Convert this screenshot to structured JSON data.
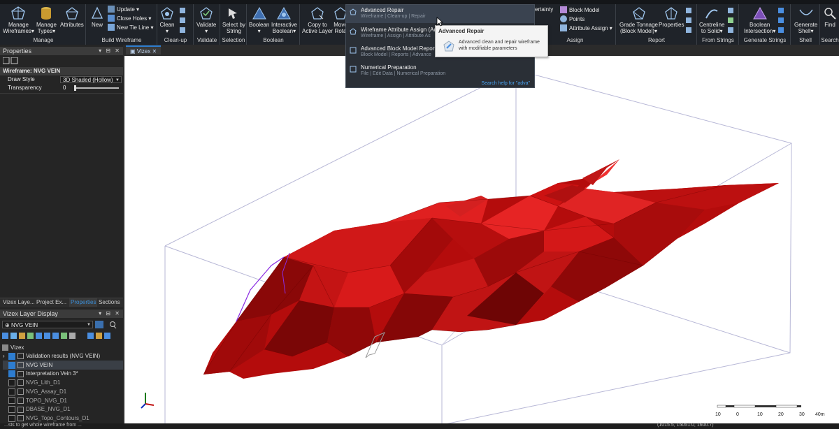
{
  "ribbon": {
    "groups": [
      {
        "label": "Manage",
        "buttons": [
          "Manage\nWireframes▾",
          "Manage\nTypes▾",
          "Attributes"
        ]
      },
      {
        "label": "Build Wireframe",
        "new": "New",
        "small": [
          "Update ▾",
          "Close Holes ▾",
          "New Tie Line ▾"
        ]
      },
      {
        "label": "Clean-up",
        "buttons": [
          "Clean\n▾"
        ]
      },
      {
        "label": "Validate",
        "buttons": [
          "Validate\n▾"
        ]
      },
      {
        "label": "Selection",
        "buttons": [
          "Select by\nString"
        ]
      },
      {
        "label": "Boolean",
        "buttons": [
          "Boolean\n▾",
          "Interactive\nBoolean▾"
        ]
      },
      {
        "label": "",
        "buttons": [
          "Copy to\nActive Layer",
          "Move\nRota"
        ]
      },
      {
        "label": "Assign",
        "small_left": "ertainty",
        "small": [
          "Block Model",
          "Points",
          "Attribute Assign ▾"
        ]
      },
      {
        "label": "Report",
        "buttons": [
          "Grade Tonnage\n(Block Model)▾",
          "Properties"
        ]
      },
      {
        "label": "From Strings",
        "buttons": [
          "Centreline\nto Solid▾"
        ]
      },
      {
        "label": "Generate Strings",
        "buttons": [
          "Boolean\nIntersection▾"
        ]
      },
      {
        "label": "Shell",
        "buttons": [
          "Generate\nShell▾"
        ]
      },
      {
        "label": "Search",
        "buttons": [
          "Find"
        ]
      }
    ]
  },
  "search_dropdown": {
    "items": [
      {
        "title": "Advanced Repair",
        "path": "Wireframe | Clean-up | Repair"
      },
      {
        "title": "Wireframe Attribute Assign (Adv",
        "path": "Wireframe | Assign | Attribute As"
      },
      {
        "title": "Advanced Block Model Report",
        "path": "Block Model | Reports | Advance"
      },
      {
        "title": "Numerical Preparation",
        "path": "File | Edit Data | Numerical Preparation"
      }
    ],
    "help": "Search help for \"adva\""
  },
  "tooltip": {
    "title": "Advanced Repair",
    "body": "Advanced clean and repair wireframe with modifiable parameters"
  },
  "properties_panel": {
    "title": "Properties",
    "header": "Wireframe: NVG VEIN",
    "rows": [
      {
        "name": "Draw Style",
        "value": "3D Shaded (Hollow)"
      },
      {
        "name": "Transparency",
        "value": "0"
      }
    ],
    "transparency_fraction": 0.0
  },
  "panel_tabs": [
    "Vizex Laye...",
    "Project Ex...",
    "Properties",
    "Sections"
  ],
  "layer_panel": {
    "title": "Vizex Layer Display",
    "selector": "NVG VEIN",
    "root": "Vizex",
    "items": [
      {
        "label": "Validation results (NVG VEIN)",
        "checked": true
      },
      {
        "label": "NVG VEIN",
        "checked": true
      },
      {
        "label": "Interpretation Vein 3*",
        "checked": true
      },
      {
        "label": "NVG_Lith_D1",
        "checked": false
      },
      {
        "label": "NVG_Assay_D1",
        "checked": false
      },
      {
        "label": "TOPO_NVG_D1",
        "checked": false
      },
      {
        "label": "DBASE_NVG_D1",
        "checked": false
      },
      {
        "label": "NVG_Topo_Contours_D1",
        "checked": false
      }
    ]
  },
  "viewport": {
    "tab": "Vizex",
    "scale_labels": [
      "10",
      "0",
      "10",
      "20",
      "30",
      "40m"
    ],
    "model_color": "#cc1010"
  },
  "status": {
    "left": "...sts to get whole wireframe from ...",
    "right": "(1015.5, 15051.0, 1600.7)"
  },
  "colors": {
    "accent": "#2e7dd0",
    "ribbon_bg": "#1f2329",
    "panel_bg": "#252525"
  }
}
